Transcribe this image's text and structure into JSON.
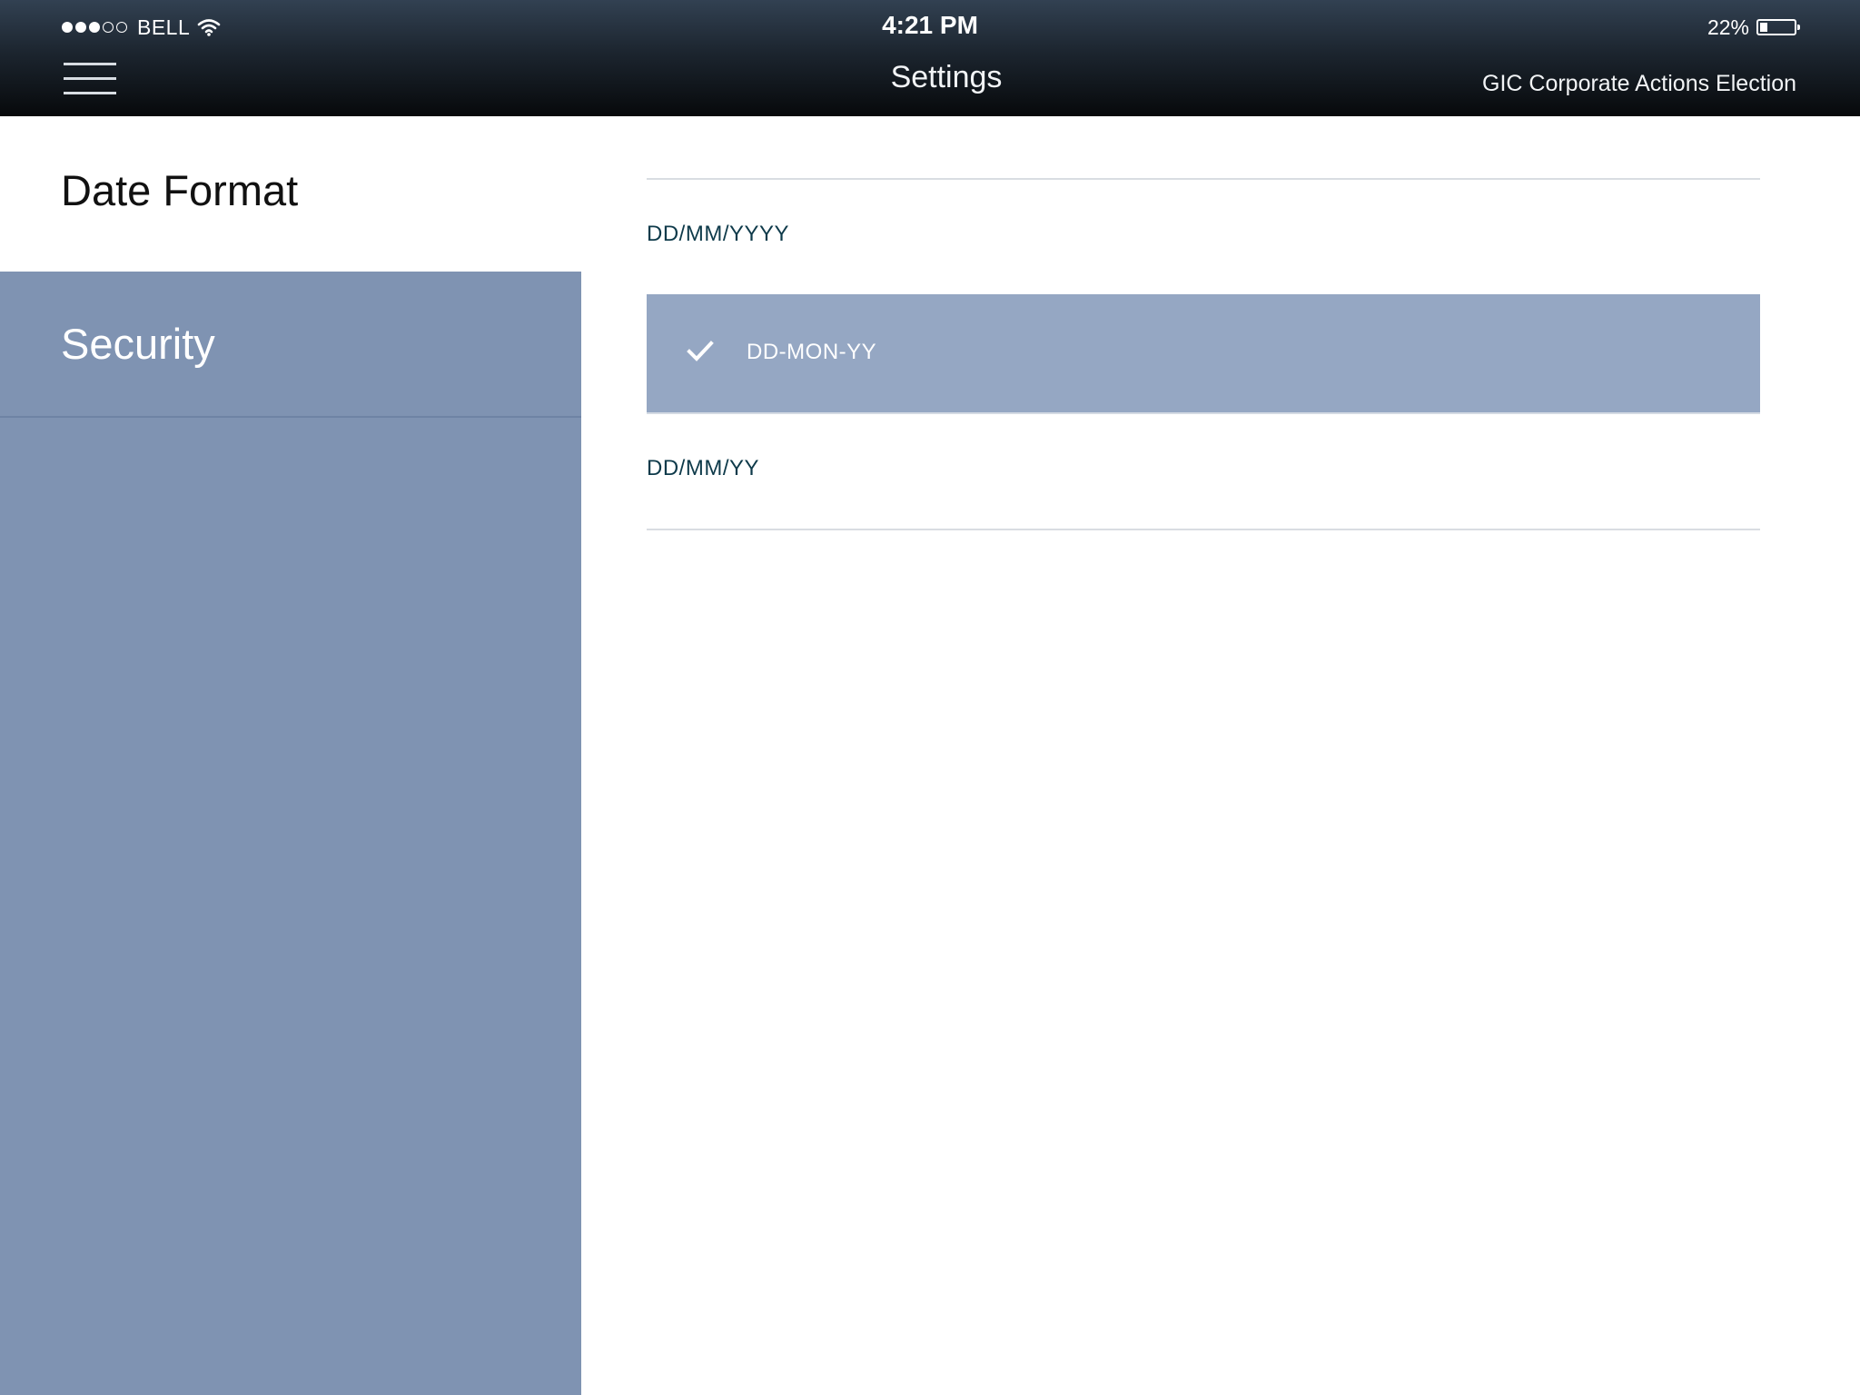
{
  "status_bar": {
    "carrier": "BELL",
    "signal_strength": "3 of 5",
    "time": "4:21 PM",
    "battery_percent": "22%"
  },
  "nav_bar": {
    "menu_icon": "hamburger-menu-icon",
    "title": "Settings",
    "app_name": "GIC Corporate Actions Election"
  },
  "sidebar": {
    "items": [
      {
        "label": "Date Format",
        "active": true
      },
      {
        "label": "Security",
        "active": false
      }
    ]
  },
  "date_formats": {
    "selected": "DD-MON-YY",
    "options": [
      {
        "label": "DD/MM/YYYY"
      },
      {
        "label": "DD-MON-YY"
      },
      {
        "label": "DD/MM/YY"
      }
    ]
  },
  "colors": {
    "sidebar_bg": "#7f93b2",
    "selected_option_bg": "#95a7c3",
    "option_text": "#0e3a4a"
  }
}
